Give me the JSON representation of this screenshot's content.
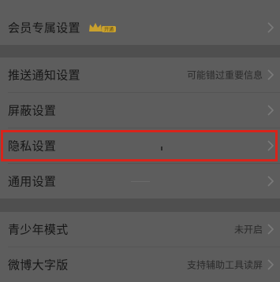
{
  "settings": {
    "vip": {
      "label": "会员专属设置",
      "badge_text": "开通"
    },
    "push": {
      "label": "推送通知设置",
      "value": "可能错过重要信息"
    },
    "block": {
      "label": "屏蔽设置"
    },
    "privacy": {
      "label": "隐私设置"
    },
    "general": {
      "label": "通用设置"
    },
    "youth": {
      "label": "青少年模式",
      "value": "未开启"
    },
    "large_font": {
      "label": "微博大字版",
      "value": "支持辅助工具读屏"
    }
  },
  "colors": {
    "highlight": "#d8241b",
    "badge": "#c9a12e",
    "dim_overlay": "#5d5d5d"
  },
  "icons": {
    "row_arrow": "chevron-right-icon",
    "vip": "crown-icon"
  }
}
